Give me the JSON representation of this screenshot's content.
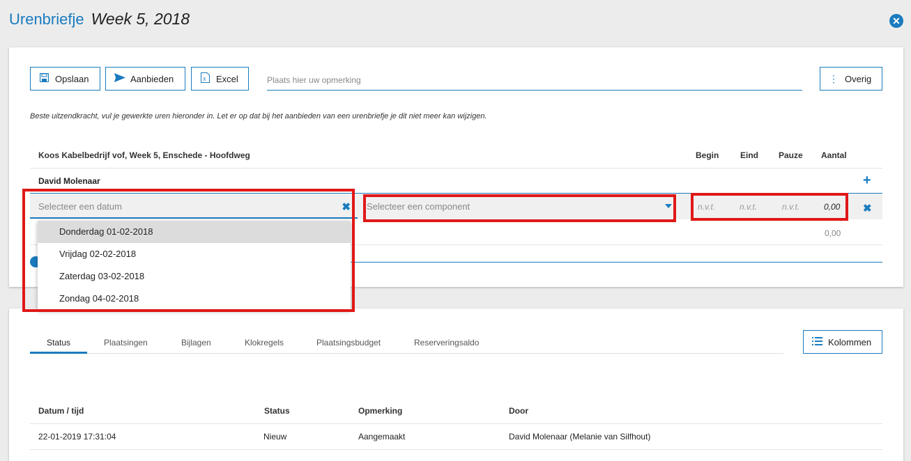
{
  "header": {
    "title": "Urenbriefje",
    "subtitle": "Week 5, 2018",
    "close_icon": "close-circle-icon"
  },
  "toolbar": {
    "save_label": "Opslaan",
    "offer_label": "Aanbieden",
    "excel_label": "Excel",
    "remark_placeholder": "Plaats hier uw opmerking",
    "more_label": "Overig"
  },
  "notice": "Beste uitzendkracht, vul je gewerkte uren hieronder in. Let er op dat bij het aanbieden van een urenbriefje je dit niet meer kan wijzigen.",
  "timesheet": {
    "placement": "Koos Kabelbedrijf vof, Week 5, Enschede - Hoofdweg",
    "columns": {
      "begin": "Begin",
      "end": "Eind",
      "pause": "Pauze",
      "amount": "Aantal"
    },
    "person": "David Molenaar",
    "entry": {
      "date_placeholder": "Selecteer een datum",
      "component_placeholder": "Selecteer een component",
      "begin": "n.v.t.",
      "end": "n.v.t.",
      "pause": "n.v.t.",
      "amount": "0,00"
    },
    "total": "0,00",
    "date_options": [
      "Donderdag 01-02-2018",
      "Vrijdag 02-02-2018",
      "Zaterdag 03-02-2018",
      "Zondag 04-02-2018"
    ]
  },
  "tabs": [
    "Status",
    "Plaatsingen",
    "Bijlagen",
    "Klokregels",
    "Plaatsingsbudget",
    "Reserveringsaldo"
  ],
  "columns_button": "Kolommen",
  "status_table": {
    "headers": [
      "Datum / tijd",
      "Status",
      "Opmerking",
      "Door"
    ],
    "rows": [
      [
        "22-01-2019 17:31:04",
        "Nieuw",
        "Aangemaakt",
        "David Molenaar (Melanie van Silfhout)"
      ]
    ]
  },
  "colors": {
    "accent": "#1a7bbf",
    "highlight": "#e01818"
  }
}
